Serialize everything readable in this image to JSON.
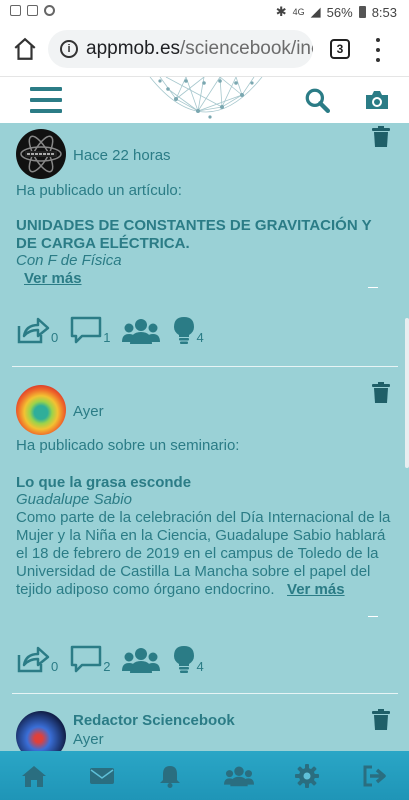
{
  "status_bar": {
    "network": "4G",
    "battery": "56%",
    "time": "8:53"
  },
  "browser": {
    "url_host": "appmob.es",
    "url_path": "/sciencebook/inc",
    "tab_count": "3"
  },
  "header": {
    "logo": "network-globe-logo"
  },
  "posts": [
    {
      "time": "Hace 22 horas",
      "intro": "Ha publicado un artículo:",
      "title": "UNIDADES DE CONSTANTES DE GRAVITACIÓN Y DE CARGA ELÉCTRICA.",
      "subtitle": "Con F de Física",
      "more": "Ver más",
      "counts": {
        "share": "0",
        "comment": "1",
        "group": "",
        "idea": "4"
      }
    },
    {
      "time": "Ayer",
      "intro": "Ha publicado sobre un seminario:",
      "title": "Lo que la grasa esconde",
      "subtitle": "Guadalupe Sabio",
      "body": "Como parte de la celebración del Día Internacional de la Mujer y la Niña en la Ciencia, Guadalupe Sabio hablará el 18 de febrero de 2019 en el campus de Toledo de la Universidad de Castilla La Mancha sobre el papel del tejido adiposo como órgano endocrino.",
      "more": "Ver más",
      "counts": {
        "share": "0",
        "comment": "2",
        "group": "",
        "idea": "4"
      }
    },
    {
      "author": "Redactor Sciencebook",
      "time": "Ayer"
    }
  ],
  "bottom_nav": [
    "home-icon",
    "mail-icon",
    "bell-icon",
    "users-icon",
    "gear-icon",
    "logout-icon"
  ],
  "colors": {
    "background": "#9ad1d6",
    "text": "#2b7c86",
    "nav": "#1f95b7"
  }
}
